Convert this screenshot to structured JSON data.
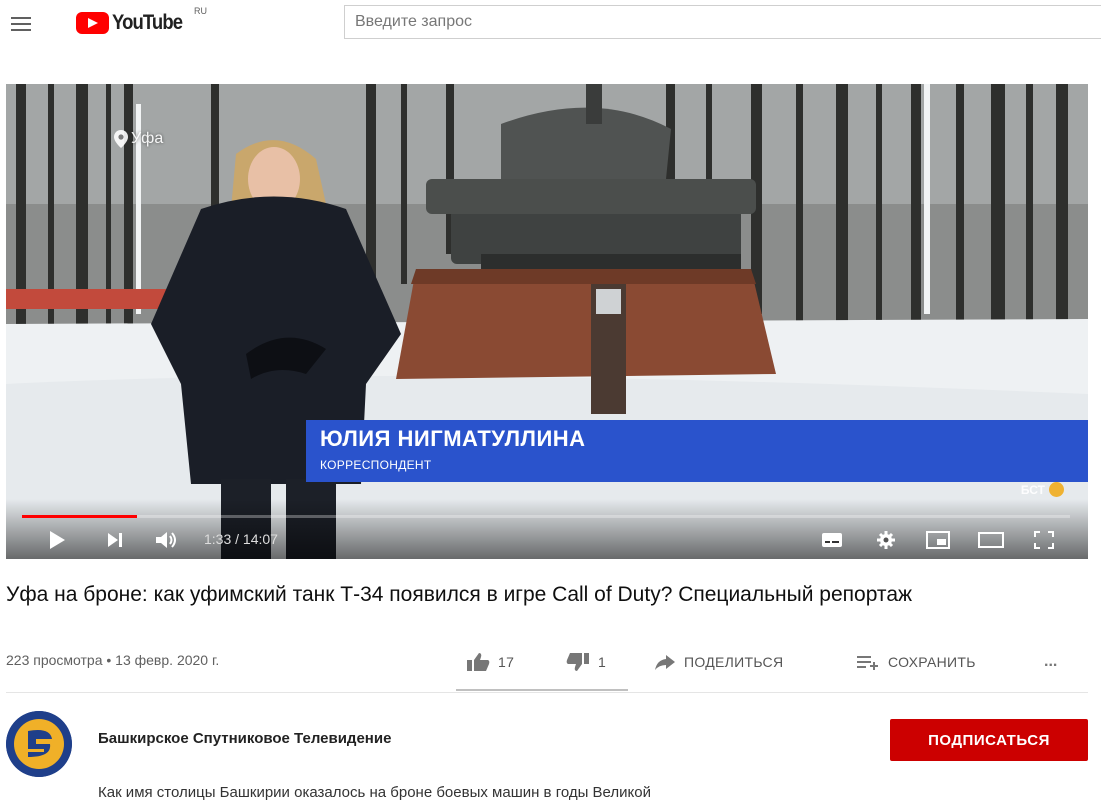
{
  "header": {
    "logo_text": "YouTube",
    "logo_region": "RU",
    "search_placeholder": "Введите запрос"
  },
  "player": {
    "location_label": "Уфа",
    "lower_third_name": "ЮЛИЯ НИГМАТУЛЛИНА",
    "lower_third_role": "КОРРЕСПОНДЕНТ",
    "channel_bug": "БСТ",
    "time_display": "1:33 / 14:07",
    "progress_fraction": 0.11,
    "accent_color": "#ff0000",
    "lower_third_color": "#2a53cc"
  },
  "video": {
    "title": "Уфа на броне: как уфимский танк Т-34 появился в игре Call of Duty? Специальный репортаж",
    "meta": "223 просмотра • 13 февр. 2020 г.",
    "likes": "17",
    "dislikes": "1",
    "share_label": "ПОДЕЛИТЬСЯ",
    "save_label": "СОХРАНИТЬ",
    "more_label": "..."
  },
  "channel": {
    "name": "Башкирское Спутниковое Телевидение",
    "subscribe_label": "ПОДПИСАТЬСЯ",
    "subscribe_color": "#cc0000",
    "description_start": "Как имя столицы Башкирии оказалось на броне боевых машин в годы Великой"
  }
}
